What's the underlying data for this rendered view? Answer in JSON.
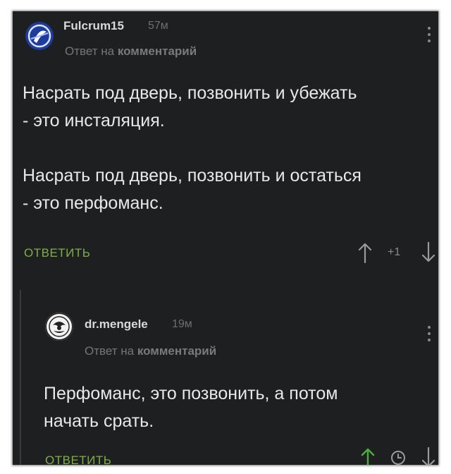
{
  "comments": [
    {
      "username": "Fulcrum15",
      "age": "57м",
      "reply_prefix": "Ответ на",
      "reply_target": "комментарий",
      "avatar_icon": "fulcrum-logo-icon",
      "body": "Насрать под дверь, позвонить и убежать\n- это инсталяция.\n\nНасрать под дверь, позвонить и остаться\n- это перфоманс.",
      "reply_label": "ОТВЕТИТЬ",
      "score": "+1",
      "upvote_icon": "arrow-up-icon",
      "downvote_icon": "arrow-down-icon",
      "upvoted": false
    },
    {
      "username": "dr.mengele",
      "age": "19м",
      "reply_prefix": "Ответ на",
      "reply_target": "комментарий",
      "avatar_icon": "emblem-avatar-icon",
      "body": "Перфоманс, это позвонить, а потом\nначать срать.",
      "reply_label": "ОТВЕТИТЬ",
      "upvote_icon": "arrow-up-icon",
      "pending_icon": "clock-icon",
      "downvote_icon": "arrow-down-icon",
      "upvoted": true
    }
  ],
  "colors": {
    "background": "#1e1f21",
    "accent_green": "#7fae47",
    "muted_text": "#767676"
  }
}
